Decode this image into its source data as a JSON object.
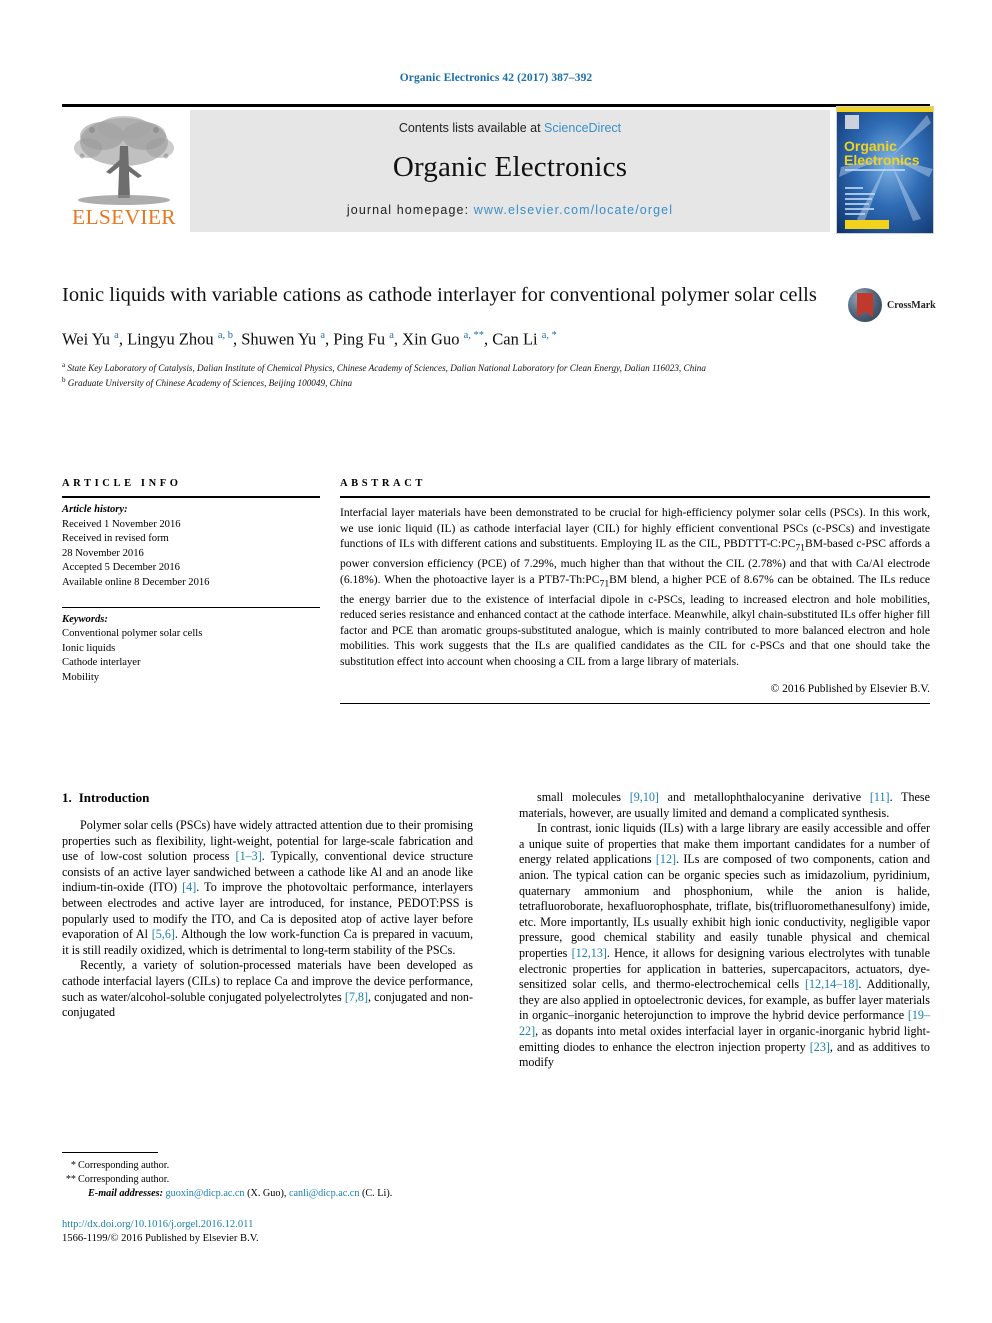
{
  "running_head": "Organic Electronics 42 (2017) 387–392",
  "masthead": {
    "contents_prefix": "Contents lists available at ",
    "sciencedirect": "ScienceDirect",
    "journal_title": "Organic Electronics",
    "homepage_label": "journal homepage: ",
    "homepage_url": "www.elsevier.com/locate/orgel",
    "publisher_logo_text": "ELSEVIER",
    "cover_title_line1": "Organic",
    "cover_title_line2": "Electronics"
  },
  "article": {
    "title": "Ionic liquids with variable cations as cathode interlayer for conventional polymer solar cells",
    "crossmark_label": "CrossMark",
    "authors_html": "Wei Yu <sup>a</sup>, Lingyu Zhou <sup>a, b</sup>, Shuwen Yu <sup>a</sup>, Ping Fu <sup>a</sup>, Xin Guo <sup>a, **</sup>, Can Li <sup>a, *</sup>",
    "affiliations": [
      "State Key Laboratory of Catalysis, Dalian Institute of Chemical Physics, Chinese Academy of Sciences, Dalian National Laboratory for Clean Energy, Dalian 116023, China",
      "Graduate University of Chinese Academy of Sciences, Beijing 100049, China"
    ],
    "affiliation_marks": [
      "a",
      "b"
    ]
  },
  "article_info": {
    "heading": "ARTICLE INFO",
    "history_label": "Article history:",
    "history": [
      "Received 1 November 2016",
      "Received in revised form",
      "28 November 2016",
      "Accepted 5 December 2016",
      "Available online 8 December 2016"
    ],
    "keywords_label": "Keywords:",
    "keywords": [
      "Conventional polymer solar cells",
      "Ionic liquids",
      "Cathode interlayer",
      "Mobility"
    ]
  },
  "abstract": {
    "heading": "ABSTRACT",
    "text": "Interfacial layer materials have been demonstrated to be crucial for high-efficiency polymer solar cells (PSCs). In this work, we use ionic liquid (IL) as cathode interfacial layer (CIL) for highly efficient conventional PSCs (c-PSCs) and investigate functions of ILs with different cations and substituents. Employing IL as the CIL, PBDTTT-C:PC71BM-based c-PSC affords a power conversion efficiency (PCE) of 7.29%, much higher than that without the CIL (2.78%) and that with Ca/Al electrode (6.18%). When the photoactive layer is a PTB7-Th:PC71BM blend, a higher PCE of 8.67% can be obtained. The ILs reduce the energy barrier due to the existence of interfacial dipole in c-PSCs, leading to increased electron and hole mobilities, reduced series resistance and enhanced contact at the cathode interface. Meanwhile, alkyl chain-substituted ILs offer higher fill factor and PCE than aromatic groups-substituted analogue, which is mainly contributed to more balanced electron and hole mobilities. This work suggests that the ILs are qualified candidates as the CIL for c-PSCs and that one should take the substitution effect into account when choosing a CIL from a large library of materials.",
    "copyright": "© 2016 Published by Elsevier B.V."
  },
  "introduction": {
    "number": "1.",
    "heading": "Introduction",
    "left_paragraphs": [
      "Polymer solar cells (PSCs) have widely attracted attention due to their promising properties such as flexibility, light-weight, potential for large-scale fabrication and use of low-cost solution process [1–3]. Typically, conventional device structure consists of an active layer sandwiched between a cathode like Al and an anode like indium-tin-oxide (ITO) [4]. To improve the photovoltaic performance, interlayers between electrodes and active layer are introduced, for instance, PEDOT:PSS is popularly used to modify the ITO, and Ca is deposited atop of active layer before evaporation of Al [5,6]. Although the low work-function Ca is prepared in vacuum, it is still readily oxidized, which is detrimental to long-term stability of the PSCs.",
      "Recently, a variety of solution-processed materials have been developed as cathode interfacial layers (CILs) to replace Ca and improve the device performance, such as water/alcohol-soluble conjugated polyelectrolytes [7,8], conjugated and non-conjugated"
    ],
    "right_paragraphs": [
      "small molecules [9,10] and metallophthalocyanine derivative [11]. These materials, however, are usually limited and demand a complicated synthesis.",
      "In contrast, ionic liquids (ILs) with a large library are easily accessible and offer a unique suite of properties that make them important candidates for a number of energy related applications [12]. ILs are composed of two components, cation and anion. The typical cation can be organic species such as imidazolium, pyridinium, quaternary ammonium and phosphonium, while the anion is halide, tetrafluoroborate, hexafluorophosphate, triflate, bis(trifluoromethanesulfony) imide, etc. More importantly, ILs usually exhibit high ionic conductivity, negligible vapor pressure, good chemical stability and easily tunable physical and chemical properties [12,13]. Hence, it allows for designing various electrolytes with tunable electronic properties for application in batteries, supercapacitors, actuators, dye-sensitized solar cells, and thermo-electrochemical cells [12,14–18]. Additionally, they are also applied in optoelectronic devices, for example, as buffer layer materials in organic–inorganic heterojunction to improve the hybrid device performance [19–22], as dopants into metal oxides interfacial layer in organic-inorganic hybrid light-emitting diodes to enhance the electron injection property [23], and as additives to modify"
    ]
  },
  "footnotes": {
    "corresponding_single": "Corresponding author.",
    "corresponding_double": "Corresponding author.",
    "mark_single": "*",
    "mark_double": "**",
    "email_label": "E-mail addresses:",
    "email1": "guoxin@dicp.ac.cn",
    "email1_owner": "(X. Guo),",
    "email2": "canli@dicp.ac.cn",
    "email2_owner": "(C. Li)."
  },
  "publication_footer": {
    "doi": "http://dx.doi.org/10.1016/j.orgel.2016.12.011",
    "issn_line": "1566-1199/© 2016 Published by Elsevier B.V."
  },
  "colors": {
    "link_blue": "#1a7fae",
    "header_blue": "#1a6ea8",
    "elsevier_orange": "#E87722",
    "band_gray": "#e6e6e6"
  }
}
